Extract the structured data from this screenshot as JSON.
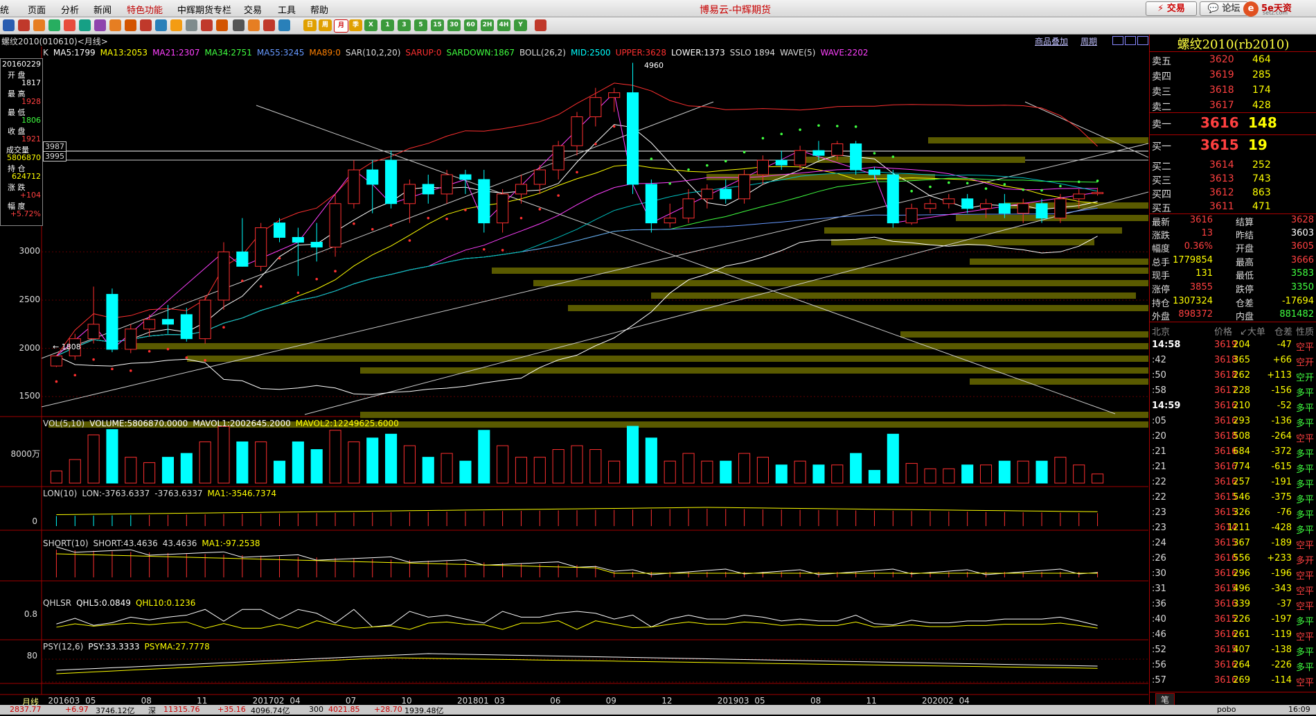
{
  "menu": {
    "items": [
      "统",
      "页面",
      "分析",
      "新闻",
      "特色功能",
      "中辉期货专栏",
      "交易",
      "工具",
      "帮助"
    ],
    "highlighted": "特色功能",
    "app_title": "博易云-中辉期货",
    "trade_btn": "交易",
    "forum_btn": "论坛",
    "logo_text": "5e天资",
    "logo_sub": "setz.com"
  },
  "toolbar": {
    "period_labels": [
      "日",
      "周",
      "月",
      "季",
      "X",
      "1",
      "3",
      "5",
      "15",
      "30",
      "60",
      "2H",
      "4H",
      "Y"
    ]
  },
  "chart_header": {
    "symbol_period": "螺纹2010(010610)<月线>",
    "link_add": "商品叠加",
    "link_period": "周期"
  },
  "indicators": {
    "main": [
      {
        "text": "K",
        "color": "#dddddd"
      },
      {
        "text": "MA5:1799",
        "color": "#ffffff"
      },
      {
        "text": "MA13:2053",
        "color": "#ffff00"
      },
      {
        "text": "MA21:2307",
        "color": "#ff40ff"
      },
      {
        "text": "MA34:2751",
        "color": "#40ff40"
      },
      {
        "text": "MA55:3245",
        "color": "#6699ff"
      },
      {
        "text": "MA89:0",
        "color": "#ff8000"
      },
      {
        "text": "SAR(10,2,20)",
        "color": "#dddddd"
      },
      {
        "text": "SARUP:0",
        "color": "#ff3030"
      },
      {
        "text": "SARDOWN:1867",
        "color": "#40ff40"
      },
      {
        "text": "BOLL(26,2)",
        "color": "#dddddd"
      },
      {
        "text": "MID:2500",
        "color": "#00ffff"
      },
      {
        "text": "UPPER:3628",
        "color": "#ff3030"
      },
      {
        "text": "LOWER:1373",
        "color": "#ffffff"
      },
      {
        "text": "SSLO 1894",
        "color": "#dddddd"
      },
      {
        "text": "WAVE(5)",
        "color": "#dddddd"
      },
      {
        "text": "WAVE:2202",
        "color": "#ff40ff"
      }
    ],
    "vol": [
      {
        "text": "VOL(5,10)",
        "color": "#dddddd"
      },
      {
        "text": "VOLUME:5806870.0000",
        "color": "#ffffff"
      },
      {
        "text": "MAVOL1:2002645.2000",
        "color": "#ffffff"
      },
      {
        "text": "MAVOL2:12249625.6000",
        "color": "#ffff00"
      }
    ],
    "lon": [
      {
        "text": "LON(10)",
        "color": "#dddddd"
      },
      {
        "text": "LON:-3763.6337",
        "color": "#dddddd"
      },
      {
        "text": "-3763.6337",
        "color": "#dddddd"
      },
      {
        "text": "MA1:-3546.7374",
        "color": "#ffff00"
      }
    ],
    "short": [
      {
        "text": "SHORT(10)",
        "color": "#dddddd"
      },
      {
        "text": "SHORT:43.4636",
        "color": "#dddddd"
      },
      {
        "text": "43.4636",
        "color": "#dddddd"
      },
      {
        "text": "MA1:-97.2538",
        "color": "#ffff00"
      }
    ],
    "qhlsr": [
      {
        "text": "QHLSR",
        "color": "#dddddd"
      },
      {
        "text": "QHL5:0.0849",
        "color": "#ffffff"
      },
      {
        "text": "QHL10:0.1236",
        "color": "#ffff00"
      }
    ],
    "psy": [
      {
        "text": "PSY(12,6)",
        "color": "#dddddd"
      },
      {
        "text": "PSY:33.3333",
        "color": "#ffffff"
      },
      {
        "text": "PSYMA:27.7778",
        "color": "#ffff00"
      }
    ]
  },
  "infobox": {
    "date": "20160229",
    "open_label": "开 盘",
    "open": "1817",
    "high_label": "最 高",
    "high": "1928",
    "low_label": "最 低",
    "low": "1806",
    "close_label": "收 盘",
    "close": "1921",
    "vol_label": "成交量",
    "vol": "5806870",
    "oi_label": "持 仓",
    "oi": "624712",
    "chg_label": "涨 跌",
    "chg": "+104",
    "amp_label": "幅 度",
    "amp": "+5.72%"
  },
  "cursor_labels": {
    "a": "3987",
    "b": "3995",
    "high_mark": "4960",
    "low_mark": "1808"
  },
  "chart_data": {
    "type": "candlestick",
    "period": "monthly",
    "x_ticks": [
      "201603",
      "05",
      "08",
      "11",
      "201702",
      "04",
      "07",
      "10",
      "201801",
      "03",
      "06",
      "09",
      "12",
      "201903",
      "05",
      "08",
      "11",
      "202002",
      "04"
    ],
    "y_ticks_main": [
      3000,
      2500,
      2000,
      1500
    ],
    "ylim_main": [
      1300,
      5000
    ],
    "candles": [
      {
        "o": 1817,
        "h": 1928,
        "l": 1806,
        "c": 1921
      },
      {
        "o": 1921,
        "h": 2150,
        "l": 1880,
        "c": 2100
      },
      {
        "o": 2100,
        "h": 2640,
        "l": 2050,
        "c": 2250
      },
      {
        "o": 2560,
        "h": 2620,
        "l": 1960,
        "c": 1990
      },
      {
        "o": 1990,
        "h": 2250,
        "l": 1950,
        "c": 2200
      },
      {
        "o": 2200,
        "h": 2350,
        "l": 2120,
        "c": 2300
      },
      {
        "o": 2300,
        "h": 2450,
        "l": 2150,
        "c": 2250
      },
      {
        "o": 2350,
        "h": 2420,
        "l": 2070,
        "c": 2100
      },
      {
        "o": 2100,
        "h": 2550,
        "l": 2050,
        "c": 2500
      },
      {
        "o": 2500,
        "h": 3100,
        "l": 2400,
        "c": 3000
      },
      {
        "o": 3000,
        "h": 3350,
        "l": 2850,
        "c": 2850
      },
      {
        "o": 2850,
        "h": 3300,
        "l": 2800,
        "c": 3250
      },
      {
        "o": 3300,
        "h": 3350,
        "l": 3100,
        "c": 3150
      },
      {
        "o": 3150,
        "h": 3250,
        "l": 2750,
        "c": 3100
      },
      {
        "o": 3100,
        "h": 3300,
        "l": 2900,
        "c": 3050
      },
      {
        "o": 3050,
        "h": 3600,
        "l": 2950,
        "c": 3500
      },
      {
        "o": 3500,
        "h": 3950,
        "l": 3450,
        "c": 3850
      },
      {
        "o": 3850,
        "h": 3950,
        "l": 3400,
        "c": 3700
      },
      {
        "o": 3950,
        "h": 4050,
        "l": 3450,
        "c": 3500
      },
      {
        "o": 3500,
        "h": 3750,
        "l": 3300,
        "c": 3700
      },
      {
        "o": 3700,
        "h": 3800,
        "l": 3500,
        "c": 3600
      },
      {
        "o": 3600,
        "h": 3850,
        "l": 3500,
        "c": 3800
      },
      {
        "o": 3800,
        "h": 3850,
        "l": 3600,
        "c": 3750
      },
      {
        "o": 3750,
        "h": 3850,
        "l": 3200,
        "c": 3300
      },
      {
        "o": 3300,
        "h": 3650,
        "l": 3200,
        "c": 3600
      },
      {
        "o": 3600,
        "h": 3800,
        "l": 3500,
        "c": 3700
      },
      {
        "o": 3700,
        "h": 3900,
        "l": 3600,
        "c": 3850
      },
      {
        "o": 3850,
        "h": 4150,
        "l": 3750,
        "c": 4100
      },
      {
        "o": 4100,
        "h": 4450,
        "l": 4000,
        "c": 4400
      },
      {
        "o": 4400,
        "h": 4700,
        "l": 4300,
        "c": 4600
      },
      {
        "o": 4600,
        "h": 4700,
        "l": 4450,
        "c": 4650
      },
      {
        "o": 4650,
        "h": 4960,
        "l": 3600,
        "c": 3700
      },
      {
        "o": 3700,
        "h": 3750,
        "l": 3200,
        "c": 3300
      },
      {
        "o": 3300,
        "h": 3500,
        "l": 3250,
        "c": 3350
      },
      {
        "o": 3350,
        "h": 3650,
        "l": 3300,
        "c": 3550
      },
      {
        "o": 3550,
        "h": 3700,
        "l": 3450,
        "c": 3650
      },
      {
        "o": 3650,
        "h": 3750,
        "l": 3500,
        "c": 3550
      },
      {
        "o": 3550,
        "h": 3850,
        "l": 3500,
        "c": 3800
      },
      {
        "o": 3800,
        "h": 4000,
        "l": 3700,
        "c": 3950
      },
      {
        "o": 3950,
        "h": 4050,
        "l": 3850,
        "c": 3900
      },
      {
        "o": 3900,
        "h": 4100,
        "l": 3850,
        "c": 4050
      },
      {
        "o": 4050,
        "h": 4150,
        "l": 3950,
        "c": 4000
      },
      {
        "o": 4000,
        "h": 4150,
        "l": 3950,
        "c": 4120
      },
      {
        "o": 4120,
        "h": 4150,
        "l": 3800,
        "c": 3850
      },
      {
        "o": 3850,
        "h": 3880,
        "l": 3750,
        "c": 3800
      },
      {
        "o": 3800,
        "h": 3850,
        "l": 3250,
        "c": 3300
      },
      {
        "o": 3300,
        "h": 3500,
        "l": 3280,
        "c": 3450
      },
      {
        "o": 3450,
        "h": 3550,
        "l": 3400,
        "c": 3500
      },
      {
        "o": 3500,
        "h": 3600,
        "l": 3450,
        "c": 3550
      },
      {
        "o": 3550,
        "h": 3600,
        "l": 3400,
        "c": 3450
      },
      {
        "o": 3450,
        "h": 3550,
        "l": 3350,
        "c": 3500
      },
      {
        "o": 3500,
        "h": 3600,
        "l": 3350,
        "c": 3400
      },
      {
        "o": 3400,
        "h": 3550,
        "l": 3300,
        "c": 3500
      },
      {
        "o": 3500,
        "h": 3550,
        "l": 3300,
        "c": 3350
      },
      {
        "o": 3350,
        "h": 3600,
        "l": 3300,
        "c": 3550
      },
      {
        "o": 3550,
        "h": 3650,
        "l": 3450,
        "c": 3600
      },
      {
        "o": 3603,
        "h": 3666,
        "l": 3583,
        "c": 3616
      }
    ],
    "volume_scale_label": "8000万",
    "lon_tick": "0",
    "qhlsr_tick": "0.8",
    "psy_tick": "80"
  },
  "right_panel": {
    "title": "螺纹2010(rb2010)",
    "asks": [
      {
        "label": "卖五",
        "price": "3620",
        "vol": "464"
      },
      {
        "label": "卖四",
        "price": "3619",
        "vol": "285"
      },
      {
        "label": "卖三",
        "price": "3618",
        "vol": "174"
      },
      {
        "label": "卖二",
        "price": "3617",
        "vol": "428"
      }
    ],
    "ask1": {
      "label": "卖一",
      "price": "3616",
      "vol": "148"
    },
    "bid1": {
      "label": "买一",
      "price": "3615",
      "vol": "19"
    },
    "bids": [
      {
        "label": "买二",
        "price": "3614",
        "vol": "252"
      },
      {
        "label": "买三",
        "price": "3613",
        "vol": "743"
      },
      {
        "label": "买四",
        "price": "3612",
        "vol": "863"
      },
      {
        "label": "买五",
        "price": "3611",
        "vol": "471"
      }
    ],
    "stats": [
      {
        "l1": "最新",
        "v1": "3616",
        "c1": "#ff4040",
        "l2": "结算",
        "v2": "3628",
        "c2": "#ff4040"
      },
      {
        "l1": "涨跌",
        "v1": "13",
        "c1": "#ff4040",
        "l2": "昨结",
        "v2": "3603",
        "c2": "#ffffff"
      },
      {
        "l1": "幅度",
        "v1": "0.36%",
        "c1": "#ff4040",
        "l2": "开盘",
        "v2": "3605",
        "c2": "#ff4040"
      },
      {
        "l1": "总手",
        "v1": "1779854",
        "c1": "#ffff00",
        "l2": "最高",
        "v2": "3666",
        "c2": "#ff4040"
      },
      {
        "l1": "现手",
        "v1": "131",
        "c1": "#ffff00",
        "l2": "最低",
        "v2": "3583",
        "c2": "#40ff40"
      },
      {
        "l1": "涨停",
        "v1": "3855",
        "c1": "#ff4040",
        "l2": "跌停",
        "v2": "3350",
        "c2": "#40ff40"
      },
      {
        "l1": "持仓",
        "v1": "1307324",
        "c1": "#ffff00",
        "l2": "仓差",
        "v2": "-17694",
        "c2": "#ffff00"
      },
      {
        "l1": "外盘",
        "v1": "898372",
        "c1": "#ff4040",
        "l2": "内盘",
        "v2": "881482",
        "c2": "#40ff40"
      }
    ],
    "ticks_header": {
      "c0": "北京",
      "c1": "价格",
      "c2": "↙大单",
      "c3": "仓差",
      "c4": "性质"
    },
    "ticks": [
      {
        "t": "14:58",
        "p": "3619",
        "v": "204",
        "d": "-47",
        "n": "空平",
        "nc": "#ff4040"
      },
      {
        "t": ":42",
        "p": "3618",
        "v": "365",
        "d": "+66",
        "n": "空开",
        "nc": "#ff4040"
      },
      {
        "t": ":50",
        "p": "3618",
        "v": "262",
        "d": "+113",
        "n": "空开",
        "nc": "#40ff40"
      },
      {
        "t": ":58",
        "p": "3617",
        "v": "228",
        "d": "-156",
        "n": "多平",
        "nc": "#40ff40"
      },
      {
        "t": "14:59",
        "p": "3616",
        "v": "210",
        "d": "-52",
        "n": "多平",
        "nc": "#40ff40"
      },
      {
        "t": ":05",
        "p": "3616",
        "v": "293",
        "d": "-136",
        "n": "多平",
        "nc": "#40ff40"
      },
      {
        "t": ":20",
        "p": "3618",
        "v": "508",
        "d": "-264",
        "n": "空平",
        "nc": "#ff4040"
      },
      {
        "t": ":21",
        "p": "3616",
        "v": "684",
        "d": "-372",
        "n": "多平",
        "nc": "#40ff40"
      },
      {
        "t": ":21",
        "p": "3616",
        "v": "774",
        "d": "-615",
        "n": "多平",
        "nc": "#40ff40"
      },
      {
        "t": ":22",
        "p": "3616",
        "v": "257",
        "d": "-191",
        "n": "多平",
        "nc": "#40ff40"
      },
      {
        "t": ":22",
        "p": "3615",
        "v": "546",
        "d": "-375",
        "n": "多平",
        "nc": "#40ff40"
      },
      {
        "t": ":23",
        "p": "3615",
        "v": "326",
        "d": "-76",
        "n": "多平",
        "nc": "#40ff40"
      },
      {
        "t": ":23",
        "p": "3614",
        "v": "1211",
        "d": "-428",
        "n": "多平",
        "nc": "#40ff40"
      },
      {
        "t": ":24",
        "p": "3615",
        "v": "367",
        "d": "-189",
        "n": "空平",
        "nc": "#ff4040"
      },
      {
        "t": ":26",
        "p": "3616",
        "v": "556",
        "d": "+233",
        "n": "多开",
        "nc": "#ff4040"
      },
      {
        "t": ":30",
        "p": "3616",
        "v": "296",
        "d": "-196",
        "n": "空平",
        "nc": "#ff4040"
      },
      {
        "t": ":31",
        "p": "3615",
        "v": "496",
        "d": "-343",
        "n": "空平",
        "nc": "#ff4040"
      },
      {
        "t": ":36",
        "p": "3616",
        "v": "339",
        "d": "-37",
        "n": "空平",
        "nc": "#ff4040"
      },
      {
        "t": ":40",
        "p": "3615",
        "v": "226",
        "d": "-197",
        "n": "多平",
        "nc": "#40ff40"
      },
      {
        "t": ":46",
        "p": "3616",
        "v": "261",
        "d": "-119",
        "n": "空平",
        "nc": "#ff4040"
      },
      {
        "t": ":52",
        "p": "3615",
        "v": "407",
        "d": "-138",
        "n": "多平",
        "nc": "#40ff40"
      },
      {
        "t": ":56",
        "p": "3616",
        "v": "264",
        "d": "-226",
        "n": "多平",
        "nc": "#40ff40"
      },
      {
        "t": ":57",
        "p": "3616",
        "v": "269",
        "d": "-114",
        "n": "空平",
        "nc": "#ff4040"
      }
    ],
    "bottom_tab": "笔"
  },
  "bottom_left_label": "月线",
  "statusbar": {
    "items": [
      "2837.77",
      "+6.97",
      "3746.12亿",
      "深",
      "11315.76",
      "+35.16",
      "4096.74亿",
      "300",
      "4021.85",
      "+28.70",
      "1939.48亿"
    ],
    "right": "pobo",
    "time": "16:09"
  },
  "colors": {
    "up": "#ff3030",
    "down": "#00ffff",
    "accent": "#c00000"
  }
}
